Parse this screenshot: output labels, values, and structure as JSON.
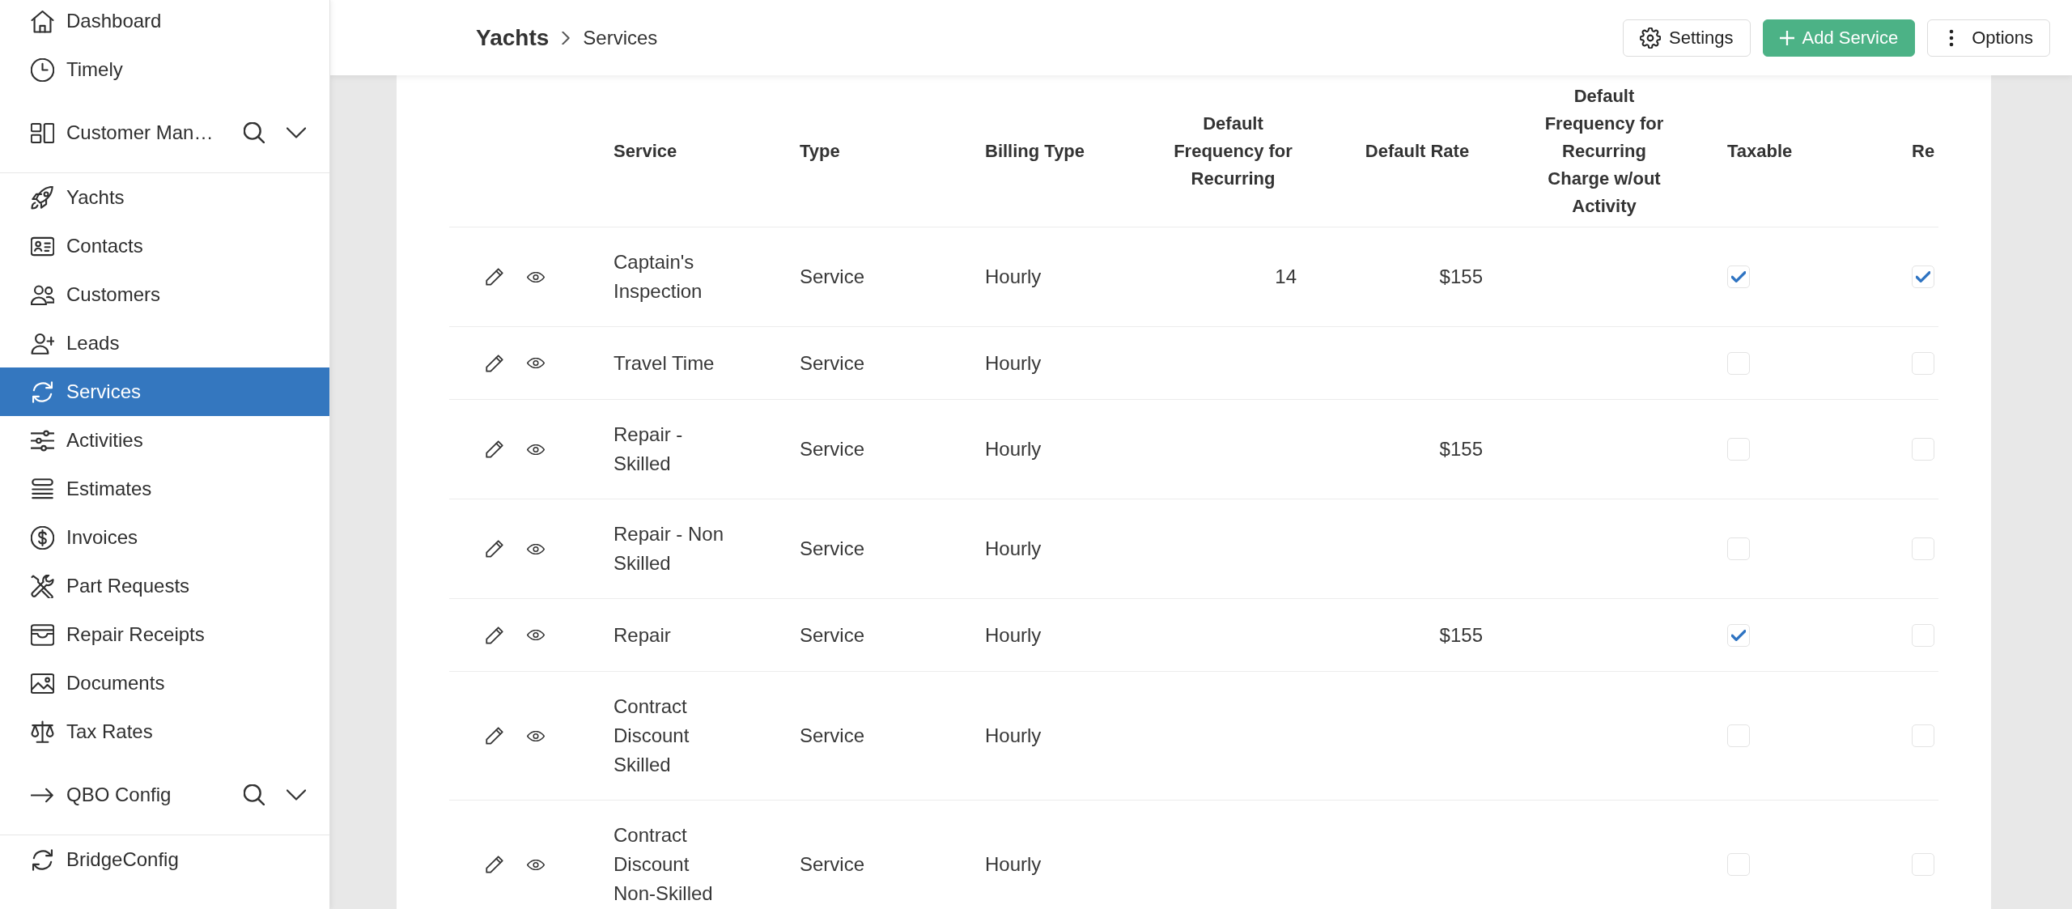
{
  "sidebar": {
    "items": [
      {
        "kind": "link",
        "label": "Dashboard",
        "selected": false
      },
      {
        "kind": "link",
        "label": "Timely",
        "selected": false
      },
      {
        "kind": "group",
        "label": "Customer Man…",
        "selected": false
      },
      {
        "kind": "link",
        "label": "Yachts",
        "selected": false
      },
      {
        "kind": "link",
        "label": "Contacts",
        "selected": false
      },
      {
        "kind": "link",
        "label": "Customers",
        "selected": false
      },
      {
        "kind": "link",
        "label": "Leads",
        "selected": false
      },
      {
        "kind": "link",
        "label": "Services",
        "selected": true
      },
      {
        "kind": "link",
        "label": "Activities",
        "selected": false
      },
      {
        "kind": "link",
        "label": "Estimates",
        "selected": false
      },
      {
        "kind": "link",
        "label": "Invoices",
        "selected": false
      },
      {
        "kind": "link",
        "label": "Part Requests",
        "selected": false
      },
      {
        "kind": "link",
        "label": "Repair Receipts",
        "selected": false
      },
      {
        "kind": "link",
        "label": "Documents",
        "selected": false
      },
      {
        "kind": "link",
        "label": "Tax Rates",
        "selected": false
      },
      {
        "kind": "group",
        "label": "QBO Config",
        "selected": false
      },
      {
        "kind": "link",
        "label": "BridgeConfig",
        "selected": false
      }
    ]
  },
  "header": {
    "breadcrumb": [
      {
        "label": "Yachts",
        "current": false
      },
      {
        "label": "Services",
        "current": true
      }
    ],
    "buttons": [
      {
        "label": "Settings",
        "kind": "default"
      },
      {
        "label": "Add Service",
        "kind": "primary"
      },
      {
        "label": "Options",
        "kind": "default"
      }
    ]
  },
  "table": {
    "columns": [
      {
        "label": "Service",
        "kind": "text"
      },
      {
        "label": "Type",
        "kind": "text"
      },
      {
        "label": "Billing Type",
        "kind": "text"
      },
      {
        "label": "Default Frequency for Recurring",
        "kind": "number"
      },
      {
        "label": "Default Rate",
        "kind": "number"
      },
      {
        "label": "Default Frequency for Recurring Charge w/out Activity",
        "kind": "number"
      },
      {
        "label": "Taxable",
        "kind": "check"
      },
      {
        "label": "Re",
        "kind": "check"
      }
    ],
    "rows": [
      {
        "service": "Captain's Inspection",
        "type": "Service",
        "billing_type": "Hourly",
        "default_frequency": "14",
        "default_rate": "$155",
        "taxable": true,
        "column_8": true
      },
      {
        "service": "Travel Time",
        "type": "Service",
        "billing_type": "Hourly",
        "taxable": false,
        "column_8": false
      },
      {
        "service": "Repair - Skilled",
        "type": "Service",
        "billing_type": "Hourly",
        "default_rate": "$155",
        "taxable": false,
        "column_8": false
      },
      {
        "service": "Repair - Non Skilled",
        "type": "Service",
        "billing_type": "Hourly",
        "taxable": false,
        "column_8": false
      },
      {
        "service": "Repair",
        "type": "Service",
        "billing_type": "Hourly",
        "default_rate": "$155",
        "taxable": true,
        "column_8": false
      },
      {
        "service": "Contract Discount Skilled",
        "type": "Service",
        "billing_type": "Hourly",
        "taxable": false,
        "column_8": false
      },
      {
        "service": "Contract Discount Non-Skilled",
        "type": "Service",
        "billing_type": "Hourly",
        "taxable": false,
        "column_8": false
      }
    ]
  }
}
